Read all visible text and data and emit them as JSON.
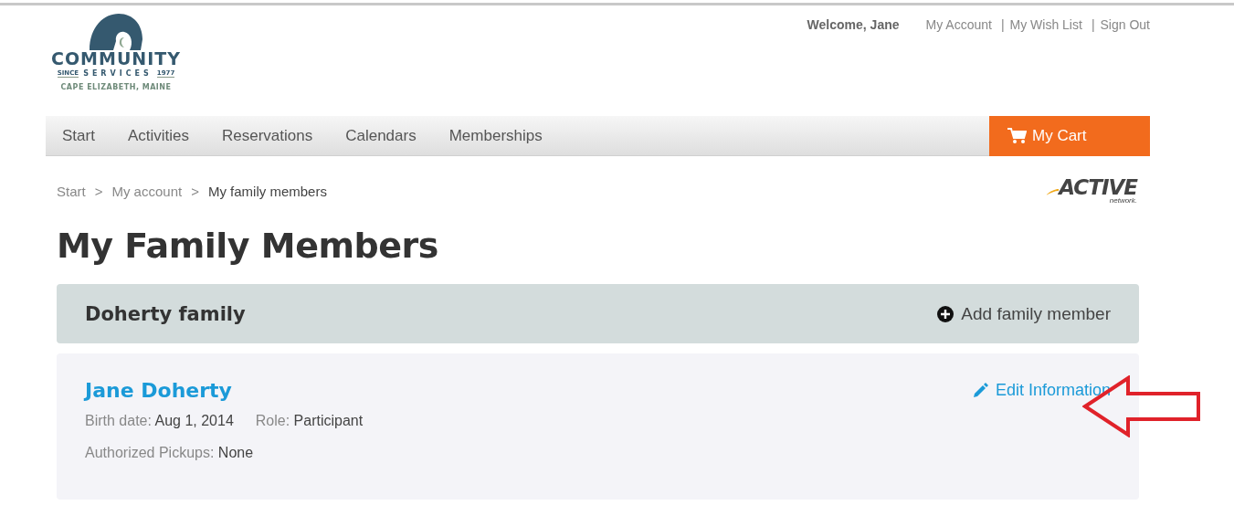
{
  "header": {
    "logo": {
      "name": "COMMUNITY",
      "since": "SINCE",
      "subname": "SERVICES",
      "year": "1977",
      "place": "CAPE ELIZABETH, MAINE"
    },
    "welcome": "Welcome, Jane",
    "links": [
      {
        "kind": "link",
        "label": "My Account"
      },
      {
        "kind": "separator",
        "label": "|"
      },
      {
        "kind": "link",
        "label": "My Wish List"
      },
      {
        "kind": "separator",
        "label": "|"
      },
      {
        "kind": "link",
        "label": "Sign Out"
      }
    ]
  },
  "nav": {
    "items": [
      {
        "label": "Start"
      },
      {
        "label": "Activities"
      },
      {
        "label": "Reservations"
      },
      {
        "label": "Calendars"
      },
      {
        "label": "Memberships"
      }
    ],
    "cart": "My Cart"
  },
  "breadcrumb": [
    {
      "kind": "link",
      "label": "Start"
    },
    {
      "kind": "separator",
      "label": ">"
    },
    {
      "kind": "link",
      "label": "My account"
    },
    {
      "kind": "separator",
      "label": ">"
    },
    {
      "kind": "current",
      "label": "My family members"
    }
  ],
  "partner_logo": {
    "name": "ACTIVE",
    "sub": "network."
  },
  "heading": "My Family Members",
  "family": {
    "name": "Doherty family",
    "add": "Add family member",
    "members": [
      {
        "name": "Jane Doherty",
        "edit": "Edit Information",
        "details": [
          [
            {
              "label": "Birth date:",
              "value": "Aug 1, 2014"
            },
            {
              "label": "Role:",
              "value": "Participant"
            }
          ],
          [
            {
              "label": "Authorized Pickups:",
              "value": "None"
            }
          ]
        ]
      }
    ]
  }
}
